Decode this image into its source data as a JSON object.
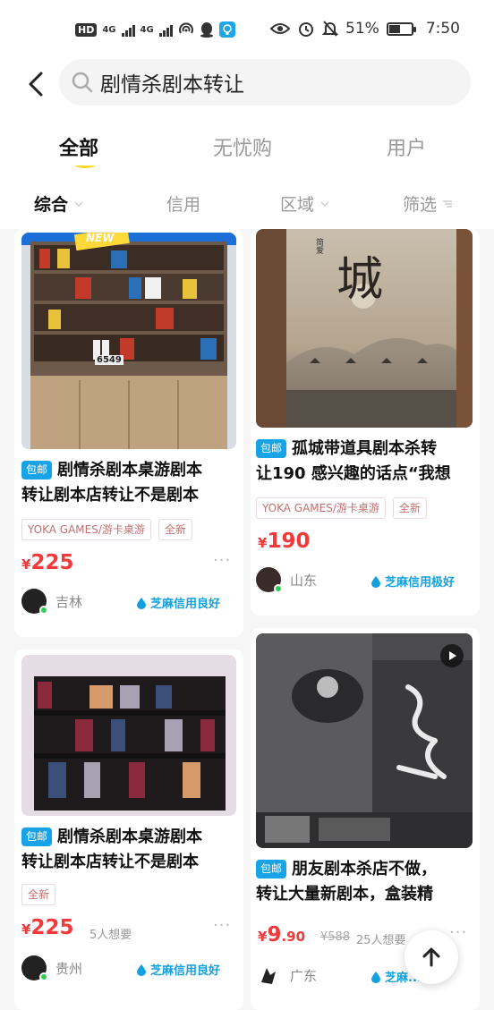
{
  "status_bar": {
    "hd": "HD",
    "net1": "4G",
    "net2": "4G",
    "battery_pct": "51%",
    "battery_level": 0.51,
    "time": "7:50",
    "icons": [
      "hd-icon",
      "signal-icon",
      "hotspot-icon",
      "qq-icon",
      "lightbulb-icon",
      "eye-icon",
      "alarm-icon",
      "mute-icon",
      "battery-icon"
    ]
  },
  "header": {
    "back_icon": "back-arrow-icon",
    "search_icon": "search-icon",
    "query": "剧情杀剧本转让"
  },
  "tabs": [
    {
      "label": "全部",
      "active": true
    },
    {
      "label": "无忧购",
      "active": false
    },
    {
      "label": "用户",
      "active": false
    }
  ],
  "filters": [
    {
      "label": "综合",
      "active": true,
      "icon": "chevron-down-icon"
    },
    {
      "label": "信用",
      "active": false
    },
    {
      "label": "区域",
      "active": false,
      "icon": "chevron-down-icon"
    },
    {
      "label": "筛选",
      "active": false,
      "icon": "filter-icon"
    }
  ],
  "items": [
    {
      "badge": "包邮",
      "title_line1": "剧情杀剧本桌游剧本",
      "title_line2": "转让剧本店转让不是剧本",
      "tags": [
        "YOKA GAMES/游卡桌游",
        "全新"
      ],
      "currency": "¥",
      "price": "225",
      "price_decimal": "",
      "original_price": "",
      "want": "",
      "location": "吉林",
      "credit": "芝麻信用良好",
      "image_text": "NEW",
      "image_text2": "6549"
    },
    {
      "badge": "包邮",
      "title_line1": "孤城带道具剧本杀转",
      "title_line2": "让190 感兴趣的话点“我想",
      "tags": [
        "YOKA GAMES/游卡桌游",
        "全新"
      ],
      "currency": "¥",
      "price": "190",
      "price_decimal": "",
      "original_price": "",
      "want": "",
      "location": "山东",
      "credit": "芝麻信用极好",
      "image_text": "城",
      "image_text2": "简爱"
    },
    {
      "badge": "包邮",
      "title_line1": "剧情杀剧本桌游剧本",
      "title_line2": "转让剧本店转让不是剧本",
      "tags": [
        "全新"
      ],
      "currency": "¥",
      "price": "225",
      "price_decimal": "",
      "original_price": "",
      "want": "5人想要",
      "location": "贵州",
      "credit": "芝麻信用良好",
      "image_text": "",
      "image_text2": ""
    },
    {
      "badge": "包邮",
      "title_line1": "朋友剧本杀店不做，",
      "title_line2": "转让大量新剧本，盒装精",
      "tags": [],
      "currency": "¥",
      "price": "9",
      "price_decimal": ".90",
      "original_price": "¥588",
      "want": "25人想要",
      "location": "广东",
      "credit": "芝麻...秀",
      "image_text": "",
      "image_text2": ""
    }
  ],
  "more_label": "···",
  "colors": {
    "accent_yellow": "#ffdb2c",
    "price_red": "#f23a3a",
    "badge_blue": "#17a3e6",
    "credit_blue": "#13a0df"
  },
  "scroll_top_icon": "arrow-up-icon",
  "play_icon": "play-icon"
}
